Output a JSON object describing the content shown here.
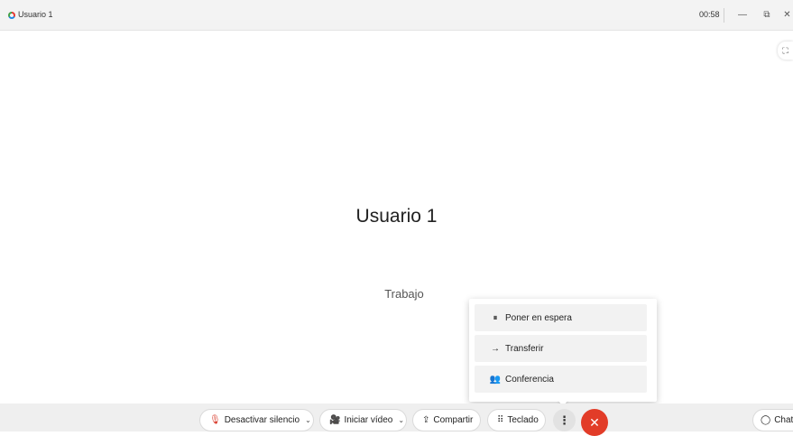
{
  "window": {
    "title": "Usuario 1",
    "timer": "00:58",
    "icons": {
      "minimize": "minimize-icon",
      "restore": "restore-icon",
      "close": "close-icon"
    },
    "minimize_glyph": "—",
    "restore_glyph": "⧉",
    "close_glyph": "✕"
  },
  "call": {
    "contact_name": "Usuario 1",
    "contact_label": "Trabajo",
    "fullscreen_glyph": "⛶"
  },
  "more_menu": {
    "items": [
      {
        "label": "Poner en espera",
        "icon": "hold-icon",
        "glyph": "⏸"
      },
      {
        "label": "Transferir",
        "icon": "transfer-arrow-icon",
        "glyph": "→"
      },
      {
        "label": "Conferencia",
        "icon": "conference-people-icon",
        "glyph": "👥"
      }
    ]
  },
  "toolbar": {
    "mute_label": "Desactivar silencio",
    "mute_glyph": "🎙",
    "video_label": "Iniciar vídeo",
    "video_glyph": "🎥",
    "share_label": "Compartir",
    "share_glyph": "⇪",
    "keypad_label": "Teclado",
    "keypad_glyph": "⠿",
    "chevron_glyph": "⌄",
    "more_glyph": "⋮",
    "hangup_glyph": "✕",
    "chat_label": "Chat",
    "chat_glyph": "◯"
  },
  "colors": {
    "hangup": "#e23c28",
    "mute_icon": "#d83b2b",
    "toolbar_bg": "#efefef",
    "titlebar_bg": "#f3f3f3"
  }
}
